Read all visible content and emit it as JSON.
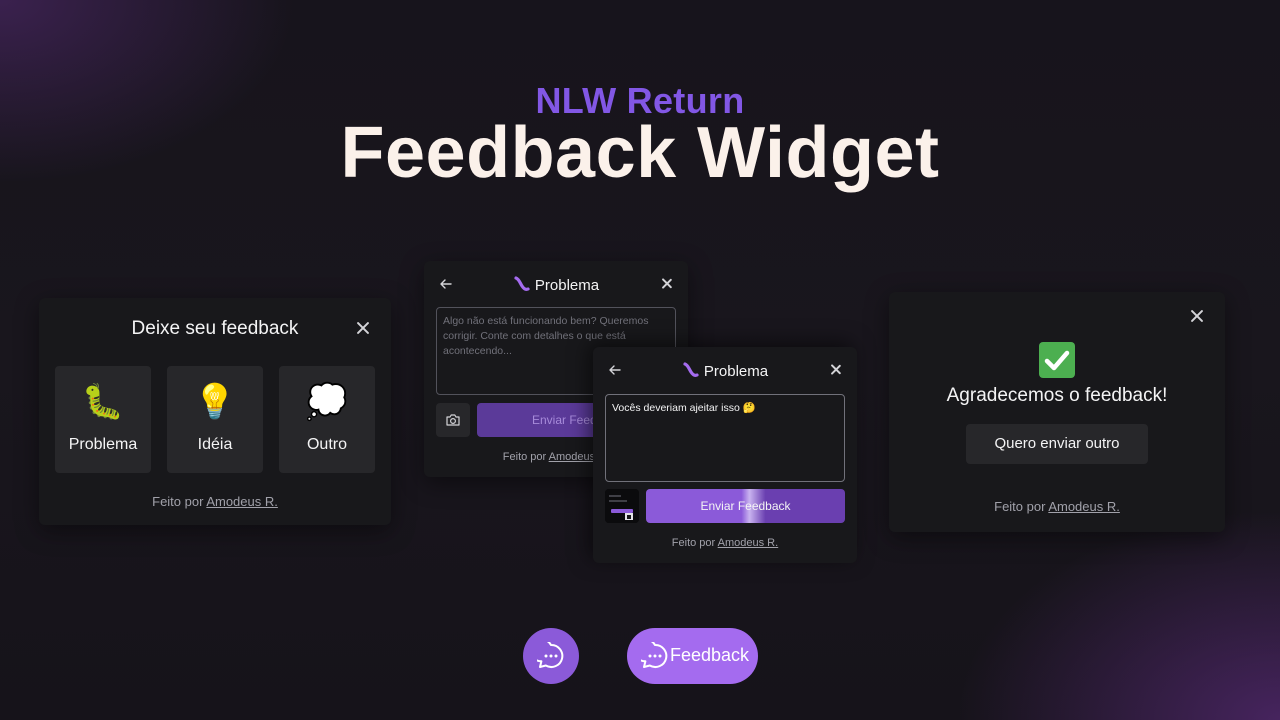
{
  "hero": {
    "eyebrow": "NLW Return",
    "title": "Feedback Widget"
  },
  "colors": {
    "brand": "#8257e5",
    "brand_light": "#a46bef",
    "card_bg": "#18181b",
    "surface": "#27272a",
    "success": "#4caf50"
  },
  "type_select_card": {
    "title": "Deixe seu feedback",
    "close_icon": "close-icon",
    "types": [
      {
        "label": "Problema",
        "emoji": "🐛",
        "icon": "bug-icon"
      },
      {
        "label": "Idéia",
        "emoji": "💡",
        "icon": "lightbulb-icon"
      },
      {
        "label": "Outro",
        "emoji": "💭",
        "icon": "thought-bubble-icon"
      }
    ],
    "footer_prefix": "Feito por ",
    "footer_link": "Amodeus R."
  },
  "content_card_empty": {
    "title": "Problema",
    "placeholder": "Algo não está funcionando bem? Queremos corrigir. Conte com detalhes o que está acontecendo...",
    "send_label": "Enviar Feedback",
    "footer_prefix": "Feito por ",
    "footer_link": "Amodeus R."
  },
  "content_card_filled": {
    "title": "Problema",
    "message": "Vocês deveriam ajeitar isso 🤔",
    "send_label": "Enviar Feedback",
    "footer_prefix": "Feito por ",
    "footer_link": "Amodeus R."
  },
  "success_card": {
    "message": "Agradecemos o feedback!",
    "again_label": "Quero enviar outro",
    "footer_prefix": "Feito por ",
    "footer_link": "Amodeus R."
  },
  "launcher": {
    "label": "Feedback"
  }
}
